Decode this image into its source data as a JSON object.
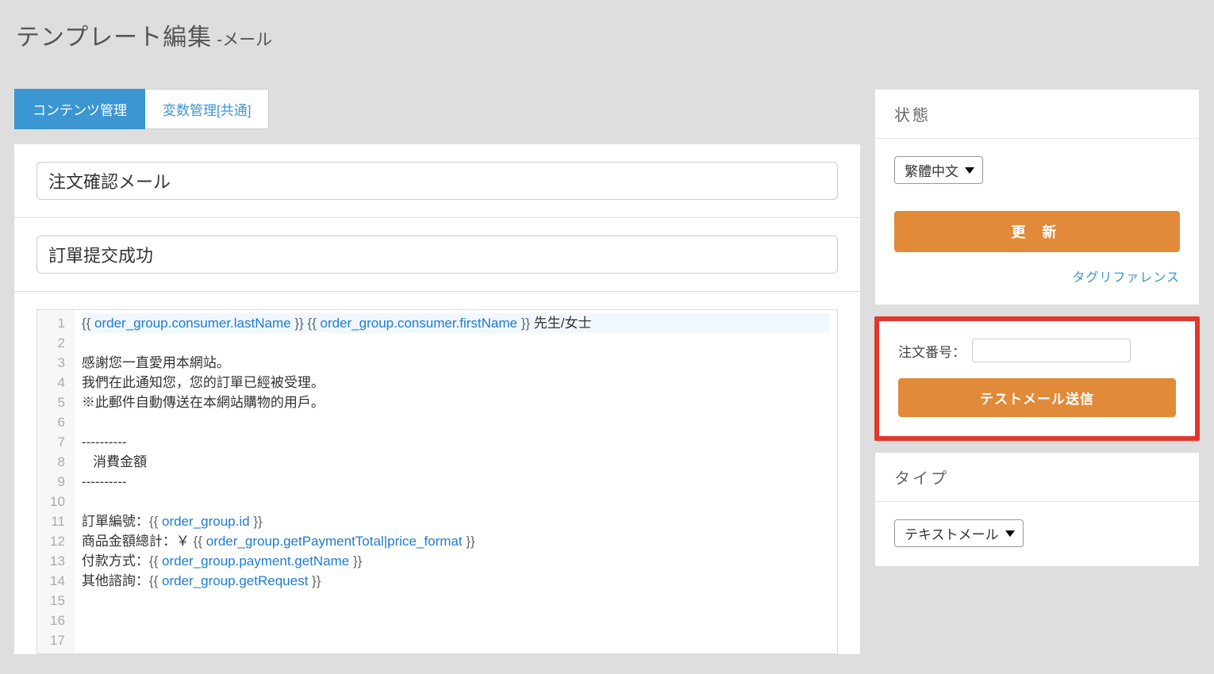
{
  "header": {
    "title": "テンプレート編集",
    "subtitle": "-メール"
  },
  "tabs": {
    "contents": "コンテンツ管理",
    "variables": "変数管理[共通]"
  },
  "inputs": {
    "template_name": "注文確認メール",
    "subject": "訂單提交成功"
  },
  "editor": {
    "lines": [
      {
        "pre": "",
        "var": "order_group.consumer.lastName",
        "mid": " ",
        "var2": "order_group.consumer.firstName",
        "post": " 先生/女士"
      },
      {
        "plain": ""
      },
      {
        "plain": "感謝您一直愛用本網站。"
      },
      {
        "plain": "我們在此通知您，您的訂單已經被受理。"
      },
      {
        "plain": "※此郵件自動傳送在本網站購物的用戶。"
      },
      {
        "plain": ""
      },
      {
        "plain": "----------"
      },
      {
        "plain": "   消費金額"
      },
      {
        "plain": "----------"
      },
      {
        "plain": ""
      },
      {
        "pre": "訂單編號：",
        "var": "order_group.id",
        "post": ""
      },
      {
        "pre": "商品金額總計：￥ ",
        "var": "order_group.getPaymentTotal|price_format",
        "post": ""
      },
      {
        "pre": "付款方式：",
        "var": "order_group.payment.getName",
        "post": ""
      },
      {
        "pre": "其他諮詢：",
        "var": "order_group.getRequest",
        "post": ""
      },
      {
        "plain": ""
      },
      {
        "plain": ""
      },
      {
        "plain": ""
      }
    ],
    "active_line_index": 0
  },
  "sidebar": {
    "status_header": "状態",
    "language_selected": "繁體中文",
    "update_label": "更 新",
    "tag_reference": "タグリファレンス",
    "order_label": "注文番号：",
    "order_value": "",
    "test_mail_label": "テストメール送信",
    "type_header": "タイプ",
    "type_selected": "テキストメール"
  }
}
